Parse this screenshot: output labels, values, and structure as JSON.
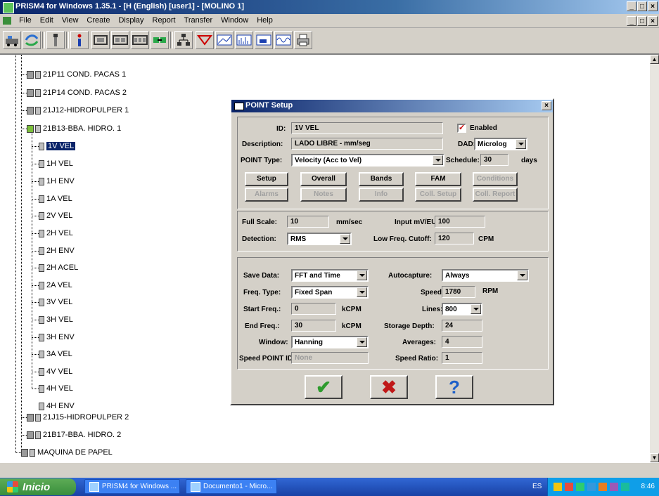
{
  "window": {
    "title": "PRISM4 for Windows 1.35.1 - [H (English) [user1] - [MOLINO 1]",
    "menu": [
      "File",
      "Edit",
      "View",
      "Create",
      "Display",
      "Report",
      "Transfer",
      "Window",
      "Help"
    ]
  },
  "toolbar": {
    "icons": [
      "route-icon",
      "transfer-icon",
      "probe-icon",
      "info-icon",
      "machine-icon",
      "machine-group-icon",
      "machine-multi-icon",
      "link-icon",
      "org-icon",
      "filter-icon",
      "graph-icon",
      "spectrum-icon",
      "trend-icon",
      "waveform-icon",
      "print-icon"
    ]
  },
  "tree": {
    "nodes": [
      {
        "label": "21P11 COND. PACAS 1"
      },
      {
        "label": "21P14 COND. PACAS 2"
      },
      {
        "label": "21J12-HIDROPULPER 1"
      },
      {
        "label": "21B13-BBA. HIDRO. 1"
      },
      {
        "label": "1V VEL"
      },
      {
        "label": "1H VEL"
      },
      {
        "label": "1H ENV"
      },
      {
        "label": "1A VEL"
      },
      {
        "label": "2V VEL"
      },
      {
        "label": "2H VEL"
      },
      {
        "label": "2H ENV"
      },
      {
        "label": "2H ACEL"
      },
      {
        "label": "2A VEL"
      },
      {
        "label": "3V VEL"
      },
      {
        "label": "3H VEL"
      },
      {
        "label": "3H ENV"
      },
      {
        "label": "3A VEL"
      },
      {
        "label": "4V VEL"
      },
      {
        "label": "4H VEL"
      },
      {
        "label": "4H ENV"
      },
      {
        "label": "21J15-HIDROPULPER 2"
      },
      {
        "label": "21B17-BBA. HIDRO. 2"
      },
      {
        "label": "MAQUINA DE PAPEL"
      }
    ]
  },
  "dialog": {
    "title": "POINT Setup",
    "id_label": "ID:",
    "id_value": "1V VEL",
    "enabled_label": "Enabled",
    "enabled": true,
    "description_label": "Description:",
    "description_value": "LADO LIBRE  -  mm/seg",
    "dad_label": "DAD:",
    "dad_value": "Microlog",
    "point_type_label": "POINT Type:",
    "point_type_value": "Velocity (Acc to Vel)",
    "schedule_label": "Schedule:",
    "schedule_value": "30",
    "schedule_unit": "days",
    "buttons_row1": [
      "Setup",
      "Overall",
      "Bands",
      "FAM",
      "Conditions"
    ],
    "buttons_row2": [
      "Alarms",
      "Notes",
      "Info",
      "Coll. Setup",
      "Coll. Report"
    ],
    "full_scale_label": "Full Scale:",
    "full_scale_value": "10",
    "full_scale_unit": "mm/sec",
    "input_mv_label": "Input mV/EU:",
    "input_mv_value": "100",
    "detection_label": "Detection:",
    "detection_value": "RMS",
    "low_freq_label": "Low Freq. Cutoff:",
    "low_freq_value": "120",
    "low_freq_unit": "CPM",
    "save_data_label": "Save Data:",
    "save_data_value": "FFT and Time",
    "autocapture_label": "Autocapture:",
    "autocapture_value": "Always",
    "freq_type_label": "Freq. Type:",
    "freq_type_value": "Fixed Span",
    "speed_label": "Speed:",
    "speed_value": "1780",
    "speed_unit": "RPM",
    "start_freq_label": "Start Freq.:",
    "start_freq_value": "0",
    "start_freq_unit": "kCPM",
    "lines_label": "Lines:",
    "lines_value": "800",
    "end_freq_label": "End Freq.:",
    "end_freq_value": "30",
    "end_freq_unit": "kCPM",
    "storage_depth_label": "Storage Depth:",
    "storage_depth_value": "24",
    "window_label": "Window:",
    "window_value": "Hanning",
    "averages_label": "Averages:",
    "averages_value": "4",
    "speed_point_label": "Speed POINT ID:",
    "speed_point_value": "None",
    "speed_ratio_label": "Speed Ratio:",
    "speed_ratio_value": "1",
    "ok_symbol": "✔",
    "cancel_symbol": "✖",
    "help_symbol": "?"
  },
  "taskbar": {
    "start_label": "Inicio",
    "items": [
      "PRISM4 for Windows ...",
      "Documento1 - Micro..."
    ],
    "tray_text": "ES",
    "clock": "8:46"
  },
  "colors": {
    "selection": "#0a246a",
    "dialog_bg": "#d4d0c8",
    "ok": "#2e9b2e",
    "cancel": "#c01818",
    "help": "#1c5fc9"
  }
}
